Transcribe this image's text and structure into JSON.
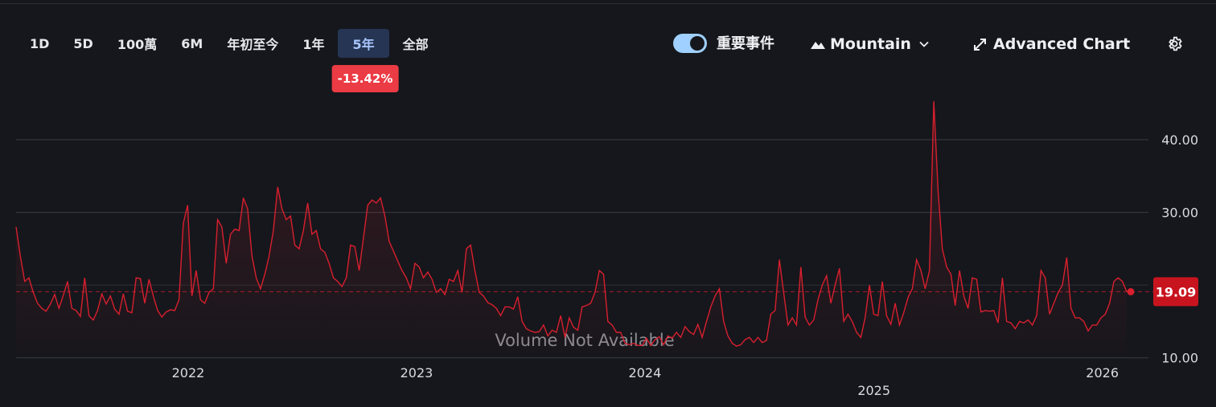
{
  "toolbar": {
    "ranges": [
      "1D",
      "5D",
      "100萬",
      "6M",
      "年初至今",
      "1年",
      "5年",
      "全部"
    ],
    "active_range": "5年",
    "change": "-13.42%"
  },
  "controls": {
    "events_label": "重要事件",
    "events_on": true,
    "chart_type": "Mountain",
    "advanced": "Advanced Chart"
  },
  "colors": {
    "line": "#d81f2e",
    "badge": "#eb3b45",
    "active_range_bg": "#263553",
    "toggle": "#9fd0ff"
  },
  "icons": {
    "chart_type": "mountain-icon",
    "chart_type_menu": "chevron-down-icon",
    "advanced": "expand-icon",
    "settings": "gear-icon"
  },
  "chart_data": {
    "type": "area",
    "x_start": "2021-04-01",
    "x_end": "2026-02-09",
    "values": [
      28,
      24,
      20.5,
      21,
      19,
      17.5,
      16.8,
      16.4,
      17.4,
      18.7,
      16.8,
      18.6,
      20.5,
      16.8,
      16.5,
      15.7,
      21,
      15.8,
      15.2,
      16.5,
      18.8,
      17.4,
      18.5,
      16.7,
      16,
      18.8,
      16.4,
      16.2,
      21,
      20.9,
      17.5,
      20.8,
      18.5,
      16.5,
      15.6,
      16.3,
      16.6,
      16.5,
      18,
      28.5,
      31,
      18.5,
      22,
      18,
      17.5,
      19,
      19.5,
      29,
      28,
      23,
      27,
      27.7,
      27.5,
      32,
      30.5,
      24,
      21,
      19.5,
      21.5,
      24,
      27.5,
      33.5,
      30.5,
      29,
      29.5,
      25.5,
      25,
      27.5,
      31.3,
      27,
      27.5,
      25,
      24.5,
      23,
      21,
      20.5,
      19.8,
      21,
      25.5,
      25.3,
      22,
      26.5,
      31,
      31.7,
      31.3,
      32,
      29.5,
      26,
      24.7,
      23.3,
      22,
      21,
      19.5,
      23,
      22.5,
      21,
      21.8,
      20.8,
      19,
      19.5,
      18.7,
      20.8,
      20.5,
      22,
      19,
      25,
      25.5,
      22,
      19,
      18.5,
      17.6,
      17.3,
      16.8,
      15.8,
      17,
      17,
      16.7,
      18.4,
      15,
      14,
      13.7,
      13.5,
      13.6,
      14.5,
      13,
      13.8,
      13.5,
      15.8,
      12.8,
      15.5,
      14.2,
      13.8,
      17,
      17.2,
      17.5,
      19,
      22,
      21.5,
      15,
      14.5,
      13.5,
      13.5,
      12,
      11.8,
      12,
      11.7,
      11.7,
      12.7,
      11.7,
      12.5,
      12.9,
      11.8,
      13,
      12.7,
      13.5,
      12.8,
      14.3,
      13.6,
      13.2,
      14.6,
      12.8,
      15,
      17,
      18.5,
      19.5,
      15,
      13,
      12,
      11.6,
      11.8,
      12.5,
      12.8,
      12.1,
      12.8,
      12.1,
      12.4,
      16,
      16.5,
      23.5,
      19,
      14.5,
      15.5,
      14.5,
      22.5,
      15.6,
      14.5,
      15.2,
      18,
      20,
      21.3,
      17.5,
      20,
      22.3,
      15,
      16,
      15,
      13.5,
      12.8,
      15.5,
      20,
      16,
      15.8,
      20.5,
      15.8,
      14.6,
      17.5,
      14.5,
      16.2,
      18.3,
      19.5,
      23.5,
      22,
      19.5,
      22,
      45.3,
      33,
      25,
      22.5,
      21.5,
      17.2,
      22,
      18.5,
      16.8,
      21,
      20.8,
      16.3,
      16.5,
      16.4,
      16.5,
      14.8,
      21,
      15,
      14.8,
      14,
      15,
      14.8,
      15.2,
      14.5,
      15.8,
      22,
      21,
      16,
      17.5,
      19,
      20,
      23.8,
      16.8,
      15.5,
      15.5,
      15,
      13.7,
      14.5,
      14.5,
      15.5,
      16,
      17.5,
      20.5,
      21,
      20.5,
      19.09
    ],
    "last_value": 19.09,
    "last_value_label": "19.09",
    "y_ticks": [
      10,
      30,
      40
    ],
    "y_tick_labels": [
      "10.00",
      "30.00",
      "40.00"
    ],
    "ylim": [
      8.2,
      49.5
    ],
    "x_ticks": [
      {
        "date": "2022-01-01",
        "label": "2022",
        "row": 1
      },
      {
        "date": "2023-01-01",
        "label": "2023",
        "row": 1
      },
      {
        "date": "2024-01-01",
        "label": "2024",
        "row": 1
      },
      {
        "date": "2025-01-01",
        "label": "2025",
        "row": 2
      },
      {
        "date": "2026-01-01",
        "label": "2026",
        "row": 1
      }
    ],
    "annotation": "Volume Not Available",
    "grid": true
  }
}
